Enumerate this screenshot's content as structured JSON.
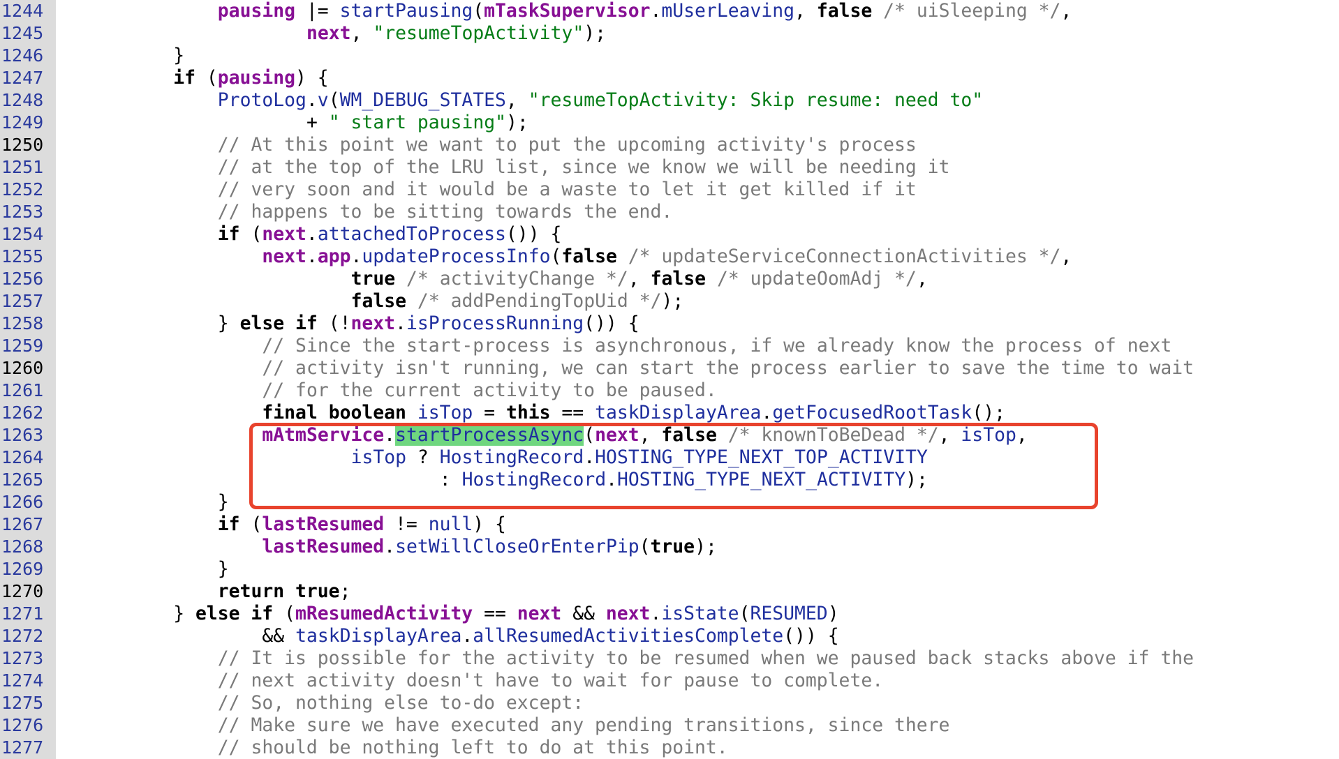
{
  "highlight_color": "#6fd67f",
  "box_color": "#e8432d",
  "current_lines": [
    "1250",
    "1260",
    "1270"
  ],
  "lines": [
    {
      "num": "1244",
      "indent": 12,
      "tokens": [
        [
          "fld",
          "pausing"
        ],
        [
          "p",
          " |= "
        ],
        [
          "mth",
          "startPausing"
        ],
        [
          "p",
          "("
        ],
        [
          "fld",
          "mTaskSupervisor"
        ],
        [
          "p",
          "."
        ],
        [
          "mth",
          "mUserLeaving"
        ],
        [
          "p",
          ", "
        ],
        [
          "kw",
          "false"
        ],
        [
          "cmt",
          " /* uiSleeping */"
        ],
        [
          "p",
          ","
        ]
      ]
    },
    {
      "num": "1245",
      "indent": 20,
      "tokens": [
        [
          "fld",
          "next"
        ],
        [
          "p",
          ", "
        ],
        [
          "str",
          "\"resumeTopActivity\""
        ],
        [
          "p",
          ");"
        ]
      ]
    },
    {
      "num": "1246",
      "indent": 8,
      "tokens": [
        [
          "p",
          "}"
        ]
      ]
    },
    {
      "num": "1247",
      "indent": 8,
      "tokens": [
        [
          "kw",
          "if"
        ],
        [
          "p",
          " ("
        ],
        [
          "fld",
          "pausing"
        ],
        [
          "p",
          ") {"
        ]
      ]
    },
    {
      "num": "1248",
      "indent": 12,
      "tokens": [
        [
          "mth",
          "ProtoLog"
        ],
        [
          "p",
          "."
        ],
        [
          "mth",
          "v"
        ],
        [
          "p",
          "("
        ],
        [
          "mth",
          "WM_DEBUG_STATES"
        ],
        [
          "p",
          ", "
        ],
        [
          "str",
          "\"resumeTopActivity: Skip resume: need to\""
        ]
      ]
    },
    {
      "num": "1249",
      "indent": 20,
      "tokens": [
        [
          "p",
          "+ "
        ],
        [
          "str",
          "\" start pausing\""
        ],
        [
          "p",
          ");"
        ]
      ]
    },
    {
      "num": "1250",
      "indent": 12,
      "tokens": [
        [
          "cmt",
          "// At this point we want to put the upcoming activity's process"
        ]
      ]
    },
    {
      "num": "1251",
      "indent": 12,
      "tokens": [
        [
          "cmt",
          "// at the top of the LRU list, since we know we will be needing it"
        ]
      ]
    },
    {
      "num": "1252",
      "indent": 12,
      "tokens": [
        [
          "cmt",
          "// very soon and it would be a waste to let it get killed if it"
        ]
      ]
    },
    {
      "num": "1253",
      "indent": 12,
      "tokens": [
        [
          "cmt",
          "// happens to be sitting towards the end."
        ]
      ]
    },
    {
      "num": "1254",
      "indent": 12,
      "tokens": [
        [
          "kw",
          "if"
        ],
        [
          "p",
          " ("
        ],
        [
          "fld",
          "next"
        ],
        [
          "p",
          "."
        ],
        [
          "mth",
          "attachedToProcess"
        ],
        [
          "p",
          "()) {"
        ]
      ]
    },
    {
      "num": "1255",
      "indent": 16,
      "tokens": [
        [
          "fld",
          "next"
        ],
        [
          "p",
          "."
        ],
        [
          "fld",
          "app"
        ],
        [
          "p",
          "."
        ],
        [
          "mth",
          "updateProcessInfo"
        ],
        [
          "p",
          "("
        ],
        [
          "kw",
          "false"
        ],
        [
          "cmt",
          " /* updateServiceConnectionActivities */"
        ],
        [
          "p",
          ","
        ]
      ]
    },
    {
      "num": "1256",
      "indent": 24,
      "tokens": [
        [
          "kw",
          "true"
        ],
        [
          "cmt",
          " /* activityChange */"
        ],
        [
          "p",
          ", "
        ],
        [
          "kw",
          "false"
        ],
        [
          "cmt",
          " /* updateOomAdj */"
        ],
        [
          "p",
          ","
        ]
      ]
    },
    {
      "num": "1257",
      "indent": 24,
      "tokens": [
        [
          "kw",
          "false"
        ],
        [
          "cmt",
          " /* addPendingTopUid */"
        ],
        [
          "p",
          ");"
        ]
      ]
    },
    {
      "num": "1258",
      "indent": 12,
      "tokens": [
        [
          "p",
          "} "
        ],
        [
          "kw",
          "else if"
        ],
        [
          "p",
          " (!"
        ],
        [
          "fld",
          "next"
        ],
        [
          "p",
          "."
        ],
        [
          "mth",
          "isProcessRunning"
        ],
        [
          "p",
          "()) {"
        ]
      ]
    },
    {
      "num": "1259",
      "indent": 16,
      "tokens": [
        [
          "cmt",
          "// Since the start-process is asynchronous, if we already know the process of next"
        ]
      ]
    },
    {
      "num": "1260",
      "indent": 16,
      "tokens": [
        [
          "cmt",
          "// activity isn't running, we can start the process earlier to save the time to wait"
        ]
      ]
    },
    {
      "num": "1261",
      "indent": 16,
      "tokens": [
        [
          "cmt",
          "// for the current activity to be paused."
        ]
      ]
    },
    {
      "num": "1262",
      "indent": 16,
      "tokens": [
        [
          "kw",
          "final boolean"
        ],
        [
          "p",
          " "
        ],
        [
          "mth",
          "isTop"
        ],
        [
          "p",
          " = "
        ],
        [
          "kw",
          "this"
        ],
        [
          "p",
          " == "
        ],
        [
          "mth",
          "taskDisplayArea"
        ],
        [
          "p",
          "."
        ],
        [
          "mth",
          "getFocusedRootTask"
        ],
        [
          "p",
          "();"
        ]
      ]
    },
    {
      "num": "1263",
      "indent": 16,
      "tokens": [
        [
          "fld",
          "mAtmService"
        ],
        [
          "p",
          "."
        ],
        [
          "mth hl",
          "startProcessAsync"
        ],
        [
          "p",
          "("
        ],
        [
          "fld",
          "next"
        ],
        [
          "p",
          ", "
        ],
        [
          "kw",
          "false"
        ],
        [
          "cmt",
          " /* knownToBeDead */"
        ],
        [
          "p",
          ", "
        ],
        [
          "mth",
          "isTop"
        ],
        [
          "p",
          ","
        ]
      ]
    },
    {
      "num": "1264",
      "indent": 24,
      "tokens": [
        [
          "mth",
          "isTop"
        ],
        [
          "p",
          " ? "
        ],
        [
          "mth",
          "HostingRecord"
        ],
        [
          "p",
          "."
        ],
        [
          "mth",
          "HOSTING_TYPE_NEXT_TOP_ACTIVITY"
        ]
      ]
    },
    {
      "num": "1265",
      "indent": 32,
      "tokens": [
        [
          "p",
          ": "
        ],
        [
          "mth",
          "HostingRecord"
        ],
        [
          "p",
          "."
        ],
        [
          "mth",
          "HOSTING_TYPE_NEXT_ACTIVITY"
        ],
        [
          "p",
          ");"
        ]
      ]
    },
    {
      "num": "1266",
      "indent": 12,
      "tokens": [
        [
          "p",
          "}"
        ]
      ]
    },
    {
      "num": "1267",
      "indent": 12,
      "tokens": [
        [
          "kw",
          "if"
        ],
        [
          "p",
          " ("
        ],
        [
          "fld",
          "lastResumed"
        ],
        [
          "p",
          " != "
        ],
        [
          "mth",
          "null"
        ],
        [
          "p",
          ") {"
        ]
      ]
    },
    {
      "num": "1268",
      "indent": 16,
      "tokens": [
        [
          "fld",
          "lastResumed"
        ],
        [
          "p",
          "."
        ],
        [
          "mth",
          "setWillCloseOrEnterPip"
        ],
        [
          "p",
          "("
        ],
        [
          "kw",
          "true"
        ],
        [
          "p",
          ");"
        ]
      ]
    },
    {
      "num": "1269",
      "indent": 12,
      "tokens": [
        [
          "p",
          "}"
        ]
      ]
    },
    {
      "num": "1270",
      "indent": 12,
      "tokens": [
        [
          "kw",
          "return true"
        ],
        [
          "p",
          ";"
        ]
      ]
    },
    {
      "num": "1271",
      "indent": 8,
      "tokens": [
        [
          "p",
          "} "
        ],
        [
          "kw",
          "else if"
        ],
        [
          "p",
          " ("
        ],
        [
          "fld",
          "mResumedActivity"
        ],
        [
          "p",
          " == "
        ],
        [
          "fld",
          "next"
        ],
        [
          "p",
          " && "
        ],
        [
          "fld",
          "next"
        ],
        [
          "p",
          "."
        ],
        [
          "mth",
          "isState"
        ],
        [
          "p",
          "("
        ],
        [
          "mth",
          "RESUMED"
        ],
        [
          "p",
          ")"
        ]
      ]
    },
    {
      "num": "1272",
      "indent": 16,
      "tokens": [
        [
          "p",
          "&& "
        ],
        [
          "mth",
          "taskDisplayArea"
        ],
        [
          "p",
          "."
        ],
        [
          "mth",
          "allResumedActivitiesComplete"
        ],
        [
          "p",
          "()) {"
        ]
      ]
    },
    {
      "num": "1273",
      "indent": 12,
      "tokens": [
        [
          "cmt",
          "// It is possible for the activity to be resumed when we paused back stacks above if the"
        ]
      ]
    },
    {
      "num": "1274",
      "indent": 12,
      "tokens": [
        [
          "cmt",
          "// next activity doesn't have to wait for pause to complete."
        ]
      ]
    },
    {
      "num": "1275",
      "indent": 12,
      "tokens": [
        [
          "cmt",
          "// So, nothing else to-do except:"
        ]
      ]
    },
    {
      "num": "1276",
      "indent": 12,
      "tokens": [
        [
          "cmt",
          "// Make sure we have executed any pending transitions, since there"
        ]
      ]
    },
    {
      "num": "1277",
      "indent": 12,
      "tokens": [
        [
          "cmt",
          "// should be nothing left to do at this point."
        ]
      ]
    }
  ]
}
